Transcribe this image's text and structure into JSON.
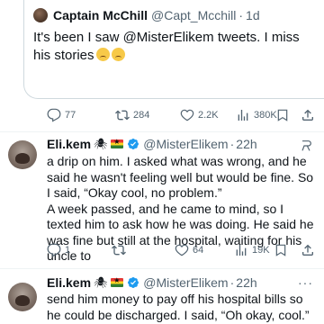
{
  "quoted_tweet": {
    "name": "Captain McChill",
    "handle": "@Capt_Mcchill",
    "separator": "·",
    "time": "1d",
    "text": "It's been I saw @MisterElikem tweets. I miss his stories",
    "emoji_icons": [
      "crying-face-icon",
      "crying-face-icon"
    ],
    "actions": {
      "replies": "77",
      "reposts": "284",
      "likes": "2.2K",
      "views": "380K"
    }
  },
  "tweets": [
    {
      "name": "Eli.kem",
      "name_emoji": "🕷",
      "handle": "@MisterElikem",
      "separator": "·",
      "time": "22h",
      "paragraphs": [
        "a drip on him. I asked what was wrong, and he said he wasn't feeling well but would be fine. So I said, “Okay cool, no problem.”",
        "A week passed, and he came to mind, so I texted him to ask how he was doing. He said he was fine but still at the hospital, waiting for his uncle to"
      ],
      "actions": {
        "replies": "1",
        "reposts": "",
        "likes": "64",
        "views": "19K"
      }
    },
    {
      "name": "Eli.kem",
      "name_emoji": "🕷",
      "handle": "@MisterElikem",
      "separator": "·",
      "time": "22h",
      "more": "···",
      "paragraphs": [
        "send him money to pay off his hospital bills so he could be discharged. I said, “Oh okay, cool.”"
      ]
    }
  ],
  "colors": {
    "text": "#0f1419",
    "secondary": "#536471",
    "verified": "#1d9bf0",
    "divider": "#eff3f4"
  }
}
